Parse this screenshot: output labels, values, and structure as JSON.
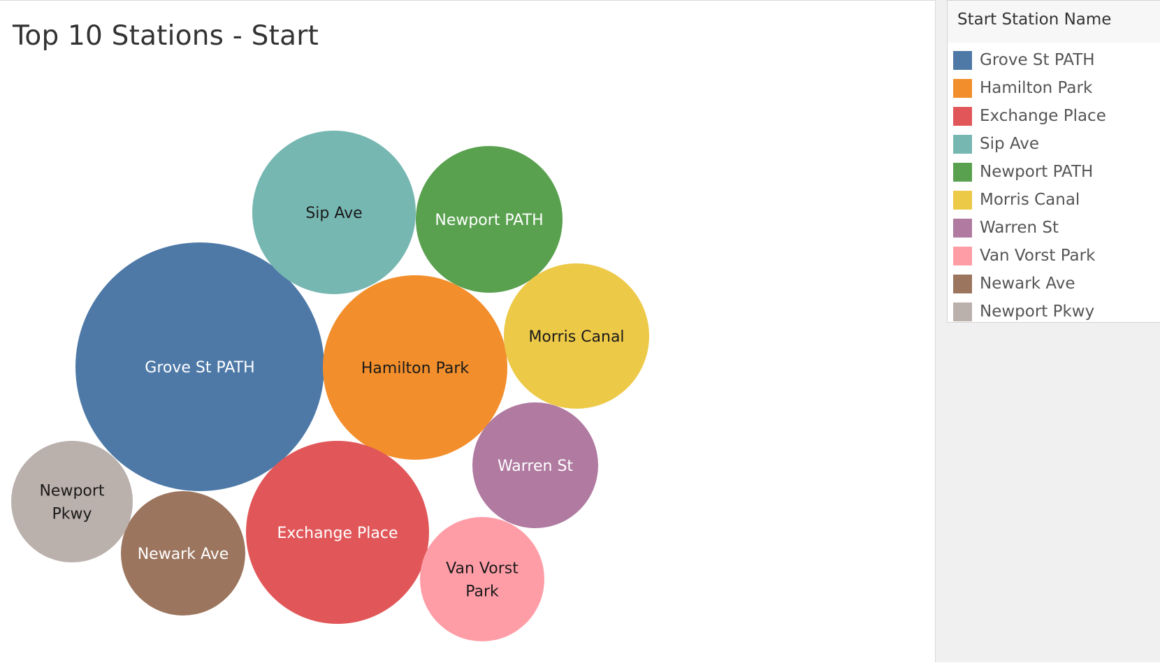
{
  "chart_data": {
    "type": "bubble",
    "title": "Top 10 Stations - Start",
    "legend": {
      "title": "Start Station Name",
      "placement": "right"
    },
    "series": [
      {
        "name": "Grove St PATH",
        "label_lines": [
          "Grove St PATH"
        ],
        "color": "#4E79A7",
        "label_color": "#ffffff"
      },
      {
        "name": "Hamilton Park",
        "label_lines": [
          "Hamilton Park"
        ],
        "color": "#F28E2B",
        "label_color": "#1a1a1a"
      },
      {
        "name": "Exchange Place",
        "label_lines": [
          "Exchange Place"
        ],
        "color": "#E15759",
        "label_color": "#ffffff"
      },
      {
        "name": "Sip Ave",
        "label_lines": [
          "Sip Ave"
        ],
        "color": "#76B7B2",
        "label_color": "#1a1a1a"
      },
      {
        "name": "Newport PATH",
        "label_lines": [
          "Newport PATH"
        ],
        "color": "#59A14F",
        "label_color": "#ffffff"
      },
      {
        "name": "Morris Canal",
        "label_lines": [
          "Morris Canal"
        ],
        "color": "#EDC948",
        "label_color": "#1a1a1a"
      },
      {
        "name": "Warren St",
        "label_lines": [
          "Warren St"
        ],
        "color": "#B07AA1",
        "label_color": "#ffffff"
      },
      {
        "name": "Van Vorst Park",
        "label_lines": [
          "Van Vorst",
          "Park"
        ],
        "color": "#FF9DA7",
        "label_color": "#1a1a1a"
      },
      {
        "name": "Newark Ave",
        "label_lines": [
          "Newark Ave"
        ],
        "color": "#9C755F",
        "label_color": "#ffffff"
      },
      {
        "name": "Newport Pkwy",
        "label_lines": [
          "Newport",
          "Pkwy"
        ],
        "color": "#BAB0AC",
        "label_color": "#1a1a1a"
      }
    ]
  }
}
